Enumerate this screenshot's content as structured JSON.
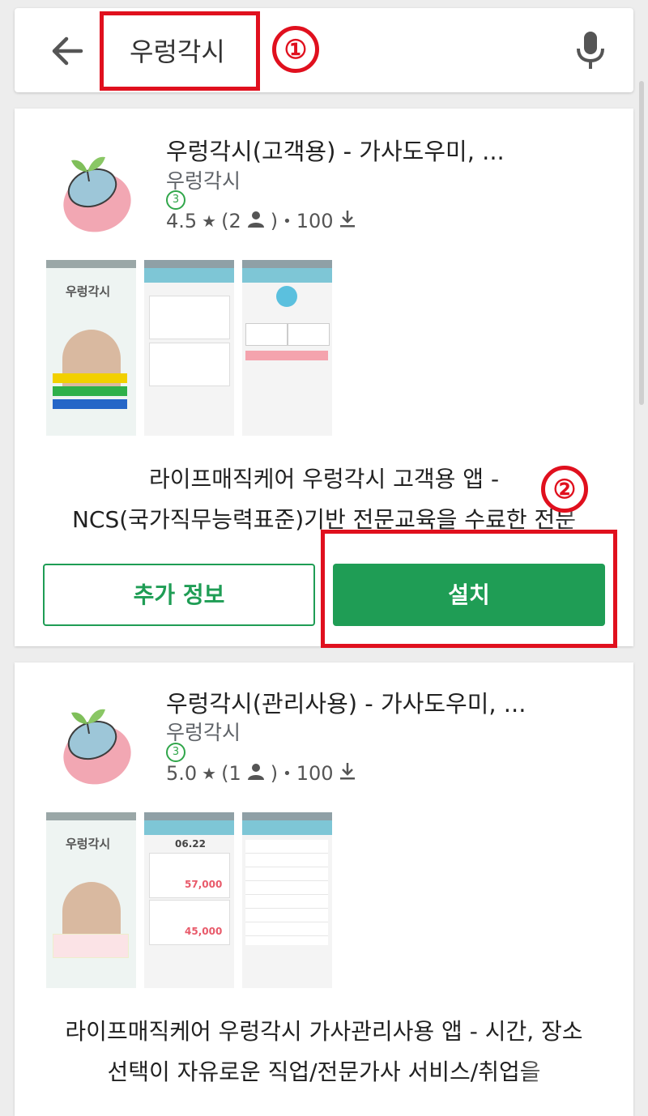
{
  "search": {
    "query": "우렁각시"
  },
  "annotations": {
    "one": "①",
    "two": "②"
  },
  "colors": {
    "accent_green": "#1f9d55",
    "annotation_red": "#e0101e"
  },
  "icons": [
    "back-arrow-icon",
    "microphone-icon",
    "star-icon",
    "person-icon",
    "download-icon",
    "rating-badge-icon"
  ],
  "results": [
    {
      "title": "우렁각시(고객용) -  가사도우미, ...",
      "developer": "우렁각시",
      "badge": "3",
      "rating": "4.5",
      "star": "★",
      "reviews_prefix": "(2",
      "reviews_suffix": ")",
      "sep": "•",
      "installs": "100",
      "shot_brand": "우렁각시",
      "description_line1": "라이프매직케어 우렁각시 고객용 앱 -",
      "description_line2": "NCS(국가직무능력표준)기반 전문교육을 수료한 전문",
      "more_info_label": "추가 정보",
      "install_label": "설치"
    },
    {
      "title": "우렁각시(관리사용)  -  가사도우미, ...",
      "developer": "우렁각시",
      "badge": "3",
      "rating": "5.0",
      "star": "★",
      "reviews_prefix": "(1",
      "reviews_suffix": ")",
      "sep": "•",
      "installs": "100",
      "shot_brand": "우렁각시",
      "shot_price1": "57,000",
      "shot_price2": "45,000",
      "shot_date": "06.22",
      "description_line1": "라이프매직케어 우렁각시 가사관리사용 앱 - 시간, 장소",
      "description_line2": "선택이 자유로운 직업/전문가사 서비스/취업을"
    }
  ]
}
